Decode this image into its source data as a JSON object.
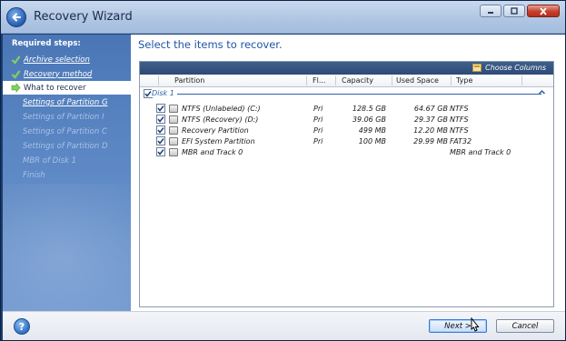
{
  "window": {
    "title": "Recovery Wizard"
  },
  "sidebar": {
    "heading": "Required steps:",
    "items": [
      {
        "label": "Archive selection",
        "state": "done"
      },
      {
        "label": "Recovery method",
        "state": "done"
      },
      {
        "label": "What to recover",
        "state": "current"
      },
      {
        "label": "Settings of Partition G",
        "state": "next"
      },
      {
        "label": "Settings of Partition I",
        "state": "pending"
      },
      {
        "label": "Settings of Partition C",
        "state": "pending"
      },
      {
        "label": "Settings of Partition D",
        "state": "pending"
      },
      {
        "label": "MBR of Disk 1",
        "state": "pending"
      },
      {
        "label": "Finish",
        "state": "pending"
      }
    ]
  },
  "main": {
    "heading": "Select the items to recover.",
    "choose_columns": "Choose Columns",
    "columns": [
      "Partition",
      "Fl...",
      "Capacity",
      "Used Space",
      "Type"
    ],
    "disk_label": "Disk 1",
    "rows": [
      {
        "checked": true,
        "partition": "NTFS (Unlabeled) (C:)",
        "flags": "Pri",
        "capacity": "128.5 GB",
        "used": "64.67 GB",
        "type": "NTFS"
      },
      {
        "checked": true,
        "partition": "NTFS (Recovery) (D:)",
        "flags": "Pri",
        "capacity": "39.06 GB",
        "used": "29.37 GB",
        "type": "NTFS"
      },
      {
        "checked": true,
        "partition": "Recovery Partition",
        "flags": "Pri",
        "capacity": "499 MB",
        "used": "12.20 MB",
        "type": "NTFS"
      },
      {
        "checked": true,
        "partition": "EFI System Partition",
        "flags": "Pri",
        "capacity": "100 MB",
        "used": "29.99 MB",
        "type": "FAT32"
      },
      {
        "checked": true,
        "partition": "MBR and Track 0",
        "flags": "",
        "capacity": "",
        "used": "",
        "type": "MBR and Track 0"
      }
    ]
  },
  "footer": {
    "help": "?",
    "next_label": "Next >",
    "cancel_label": "Cancel"
  },
  "colors": {
    "sidebar_blue": "#5a86c3",
    "heading_blue": "#1f55a3",
    "panel_bar": "#2d4a75",
    "close_red": "#c7402c"
  }
}
